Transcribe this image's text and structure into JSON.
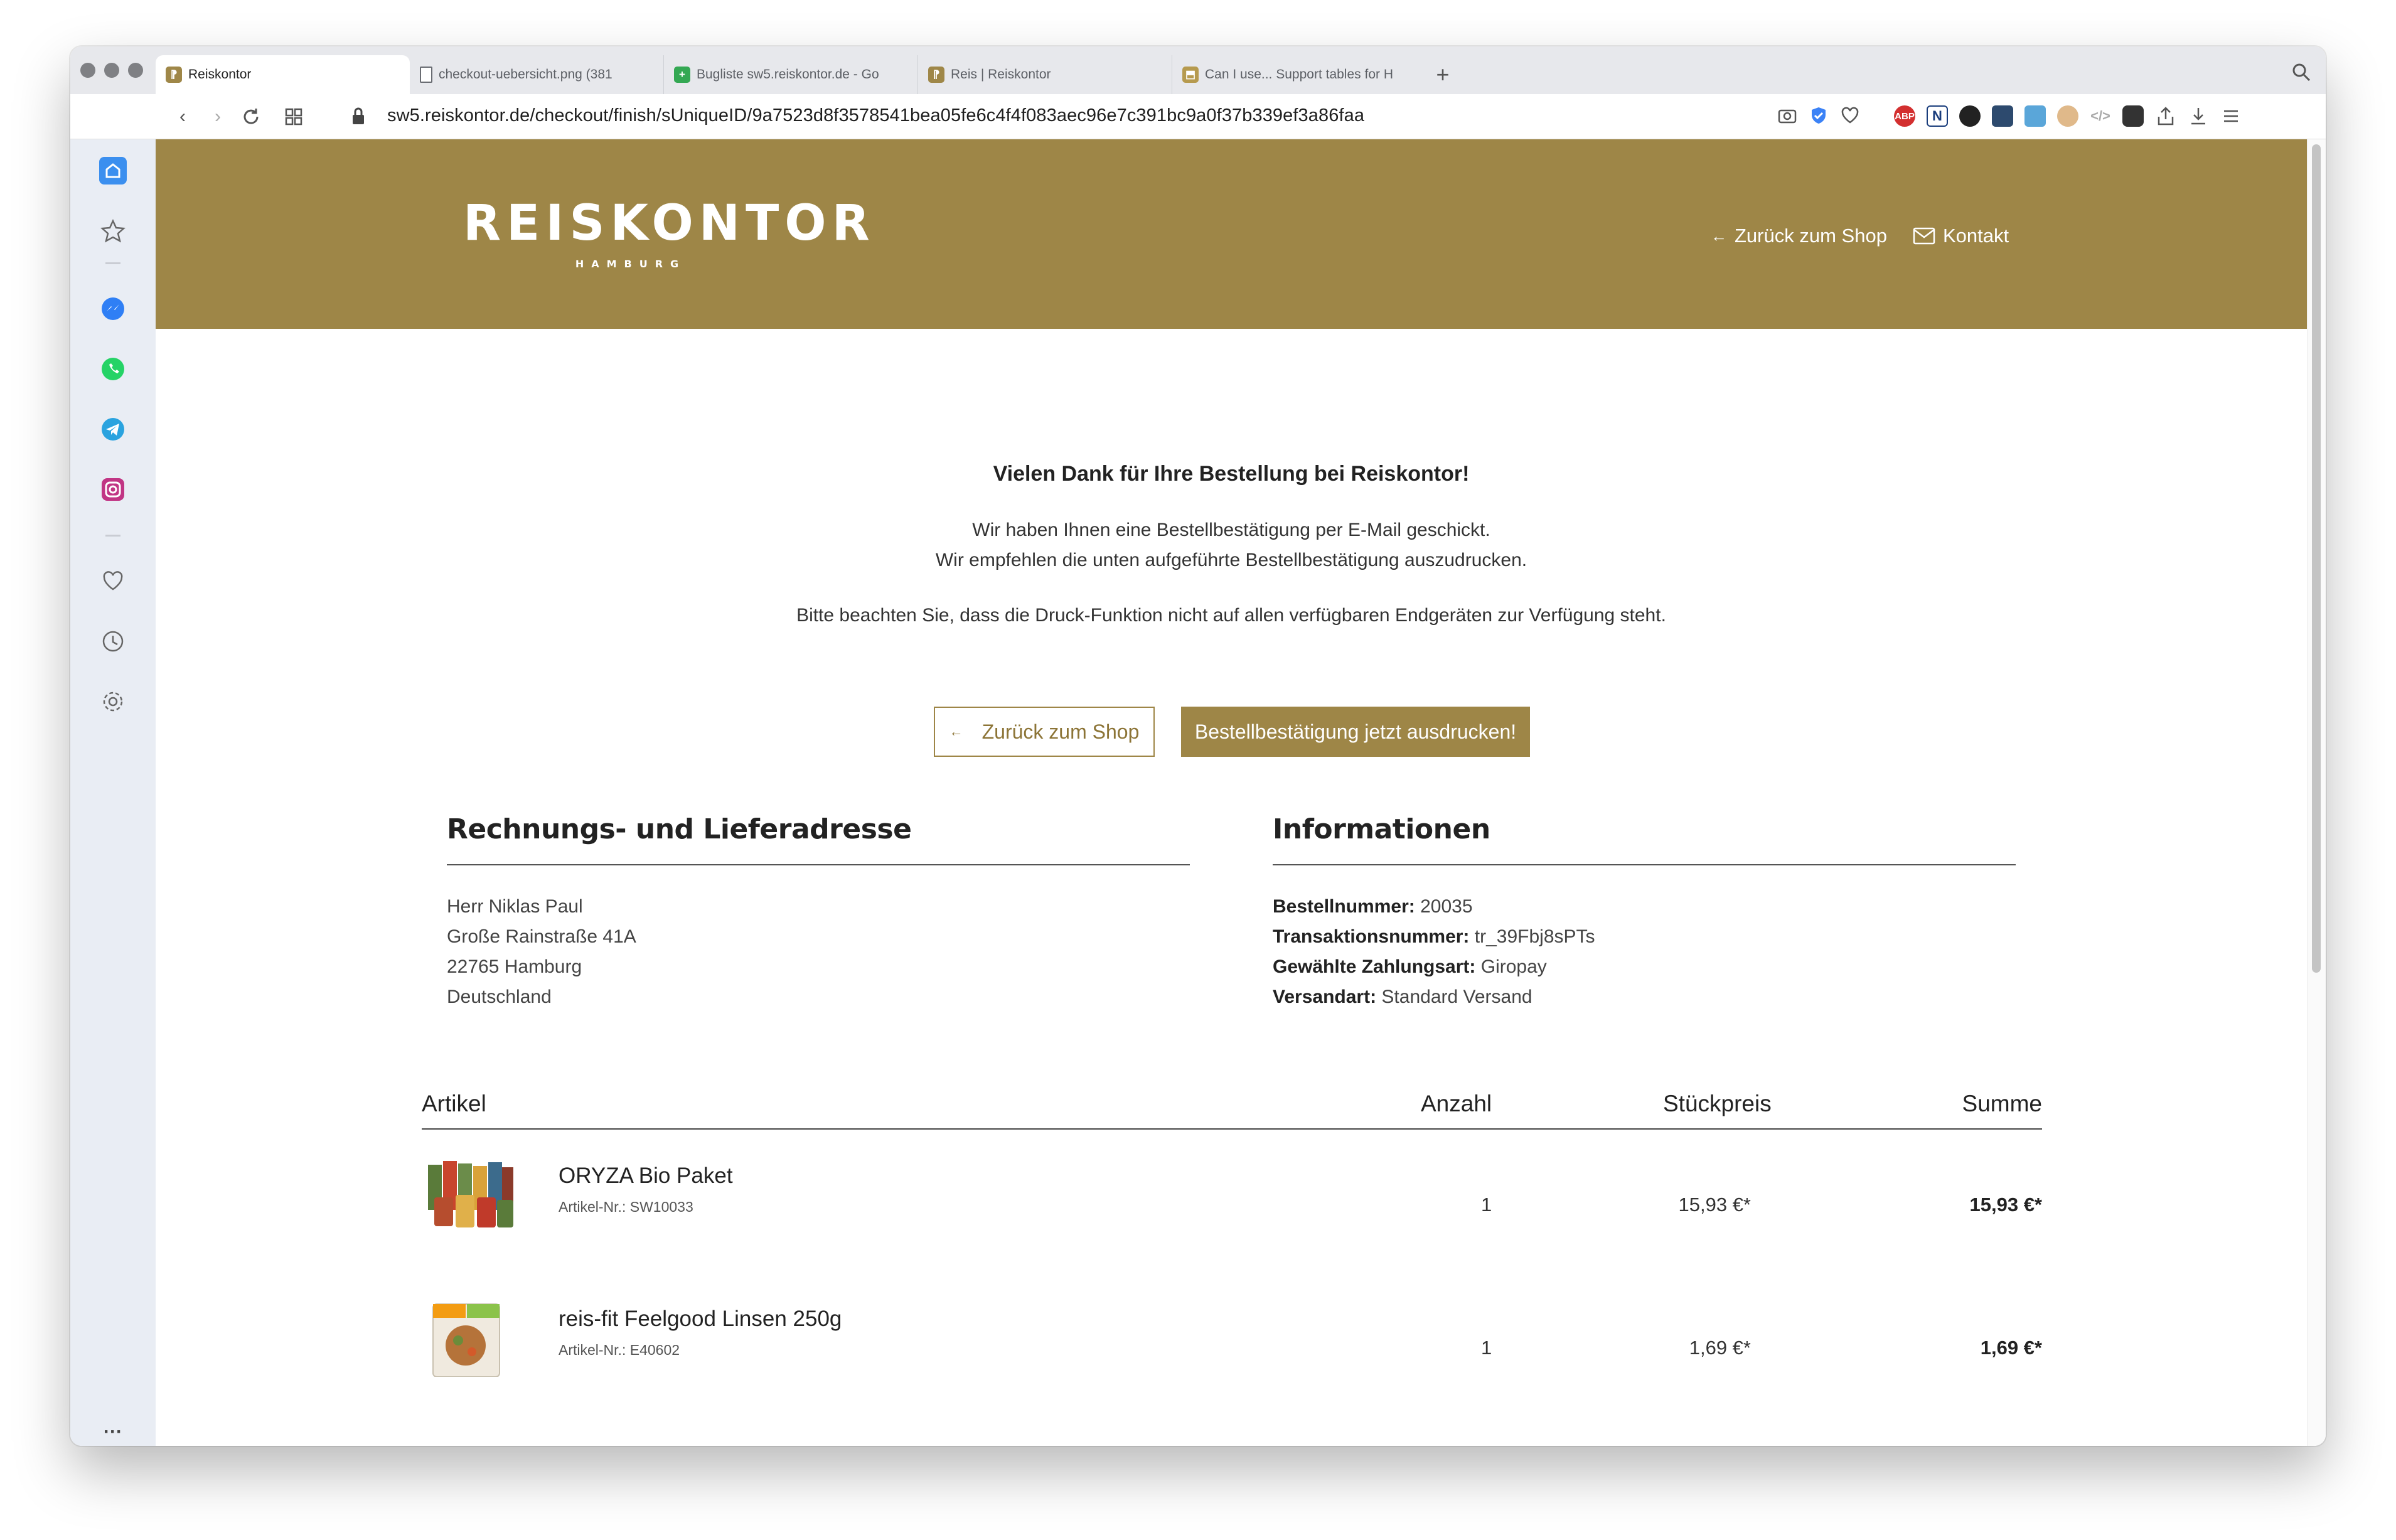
{
  "browser": {
    "tabs": [
      {
        "title": "Reiskontor",
        "icon": "reiskontor-favicon",
        "active": true
      },
      {
        "title": "checkout-uebersicht.png (381",
        "icon": "document-icon",
        "active": false
      },
      {
        "title": "Bugliste sw5.reiskontor.de - Go",
        "icon": "sheets-icon",
        "active": false
      },
      {
        "title": "Reis | Reiskontor",
        "icon": "reiskontor-favicon",
        "active": false
      },
      {
        "title": "Can I use... Support tables for H",
        "icon": "caniuse-icon",
        "active": false
      }
    ],
    "new_tab": "+",
    "url": "sw5.reiskontor.de/checkout/finish/sUniqueID/9a7523d8f3578541bea05fe6c4f4f083aec96e7c391bc9a0f37b339ef3a86faa",
    "extensions": [
      "ABP",
      "N"
    ]
  },
  "sidebar": {
    "more": "···"
  },
  "header": {
    "logo_main": "REISKONTOR",
    "logo_sub": "HAMBURG",
    "back_link": "Zurück zum Shop",
    "contact_link": "Kontakt",
    "color": "#9e8647"
  },
  "confirmation": {
    "title": "Vielen Dank für Ihre Bestellung bei Reiskontor!",
    "line1": "Wir haben Ihnen eine Bestellbestätigung per E-Mail geschickt.",
    "line2": "Wir empfehlen die unten aufgeführte Bestellbestätigung auszudrucken.",
    "line3": "Bitte beachten Sie, dass die Druck-Funktion nicht auf allen verfügbaren Endgeräten zur Verfügung steht.",
    "back_button": "Zurück zum Shop",
    "print_button": "Bestellbestätigung jetzt ausdrucken!"
  },
  "address": {
    "heading": "Rechnungs- und Lieferadresse",
    "name": "Herr Niklas Paul",
    "street": "Große Rainstraße 41A",
    "city": "22765 Hamburg",
    "country": "Deutschland"
  },
  "info": {
    "heading": "Informationen",
    "order_label": "Bestellnummer:",
    "order_value": "20035",
    "transaction_label": "Transaktionsnummer:",
    "transaction_value": "tr_39Fbj8sPTs",
    "payment_label": "Gewählte Zahlungsart:",
    "payment_value": "Giropay",
    "shipping_label": "Versandart:",
    "shipping_value": "Standard Versand"
  },
  "table": {
    "headers": {
      "article": "Artikel",
      "quantity": "Anzahl",
      "unit_price": "Stückpreis",
      "sum": "Summe"
    },
    "rows": [
      {
        "name": "ORYZA Bio Paket",
        "number": "Artikel-Nr.: SW10033",
        "quantity": "1",
        "unit_price": "15,93 €*",
        "sum": "15,93 €*"
      },
      {
        "name": "reis-fit Feelgood Linsen 250g",
        "number": "Artikel-Nr.: E40602",
        "quantity": "1",
        "unit_price": "1,69 €*",
        "sum": "1,69 €*"
      }
    ]
  }
}
